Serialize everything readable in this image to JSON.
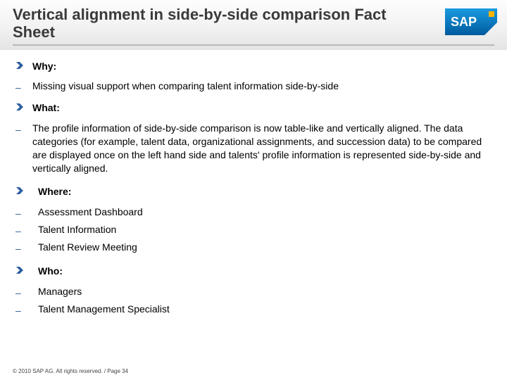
{
  "title": "Vertical alignment in side-by-side comparison Fact Sheet",
  "logo_text": "SAP",
  "sections": {
    "why": {
      "heading": "Why:",
      "items": [
        "Missing visual support when comparing talent information side-by-side"
      ]
    },
    "what": {
      "heading": "What:",
      "items": [
        "The profile information of side-by-side comparison is now table-like and vertically aligned. The data categories (for example, talent data, organizational assignments, and succession data) to be compared are displayed once on the left hand side and talents' profile information is represented side-by-side and vertically aligned."
      ]
    },
    "where": {
      "heading": "Where:",
      "items": [
        "Assessment Dashboard",
        "Talent Information",
        "Talent Review Meeting"
      ]
    },
    "who": {
      "heading": "Who:",
      "items": [
        "Managers",
        "Talent Management Specialist"
      ]
    }
  },
  "footer": "© 2010 SAP AG. All rights reserved. / Page 34"
}
